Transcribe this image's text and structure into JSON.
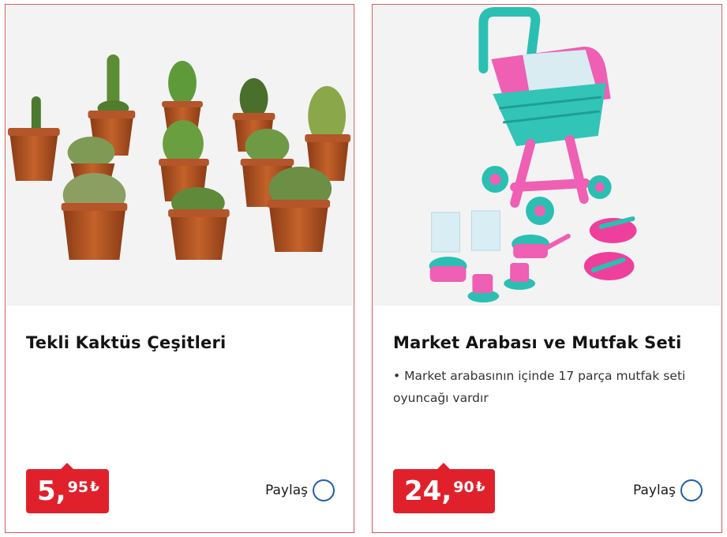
{
  "products": [
    {
      "title": "Tekli Kaktüs Çeşitleri",
      "description": "",
      "price_main": "5",
      "price_decimal": "95",
      "currency": "₺",
      "share_label": "Paylaş",
      "image": "potted cacti assortment"
    },
    {
      "title": "Market Arabası ve Mutfak Seti",
      "description": "• Market arabasının içinde 17 parça mutfak seti oyuncağı vardır",
      "price_main": "24",
      "price_decimal": "90",
      "currency": "₺",
      "share_label": "Paylaş",
      "image": "toy shopping cart with kitchen set"
    }
  ],
  "colors": {
    "price_badge": "#e0212b",
    "card_border": "#d4575a",
    "share_circle": "#1f5fa6",
    "image_bg": "#f3f3f3"
  }
}
